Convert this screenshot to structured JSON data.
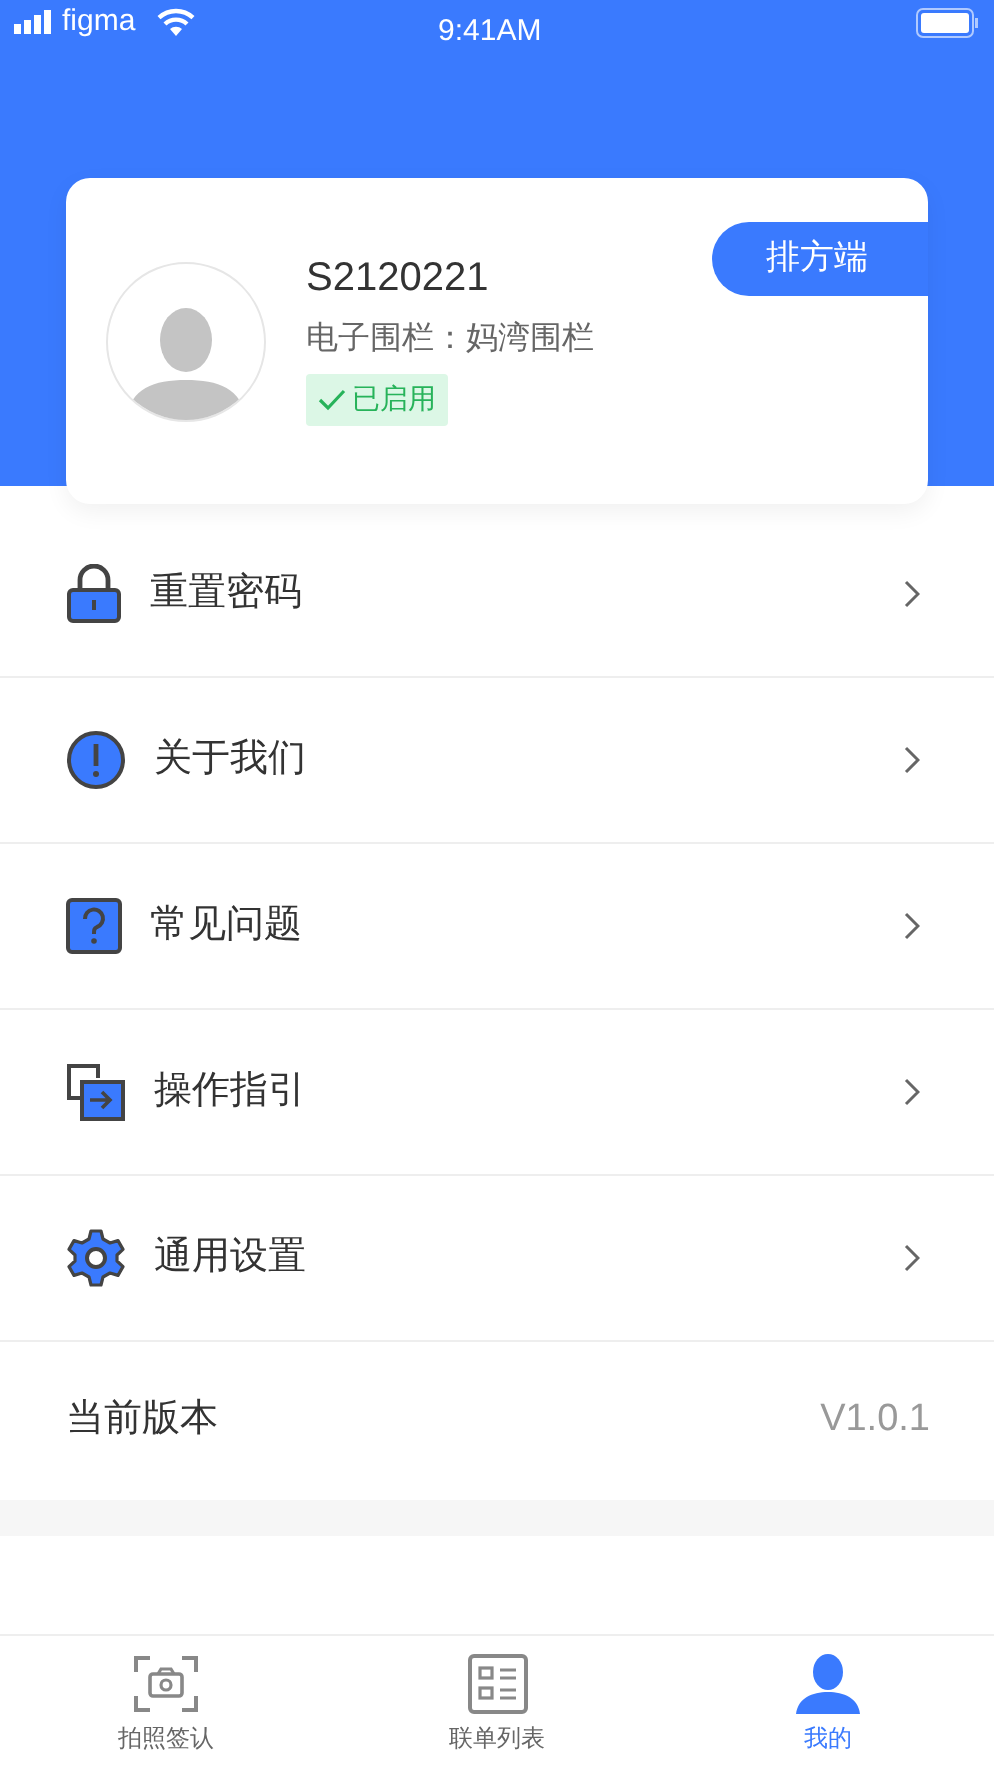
{
  "status_bar": {
    "carrier": "figma",
    "time": "9:41AM"
  },
  "profile": {
    "name": "S2120221",
    "fence": "电子围栏：妈湾围栏",
    "status": {
      "label": "已启用",
      "enabled": true
    },
    "role_button": "排方端"
  },
  "menu": [
    {
      "label": "重置密码"
    },
    {
      "label": "关于我们"
    },
    {
      "label": "常见问题"
    },
    {
      "label": "操作指引"
    },
    {
      "label": "通用设置"
    }
  ],
  "version": {
    "label": "当前版本",
    "value": "V1.0.1"
  },
  "tabs": [
    {
      "label": "拍照签认",
      "selected": false
    },
    {
      "label": "联单列表",
      "selected": false
    },
    {
      "label": "我的",
      "selected": true
    }
  ]
}
